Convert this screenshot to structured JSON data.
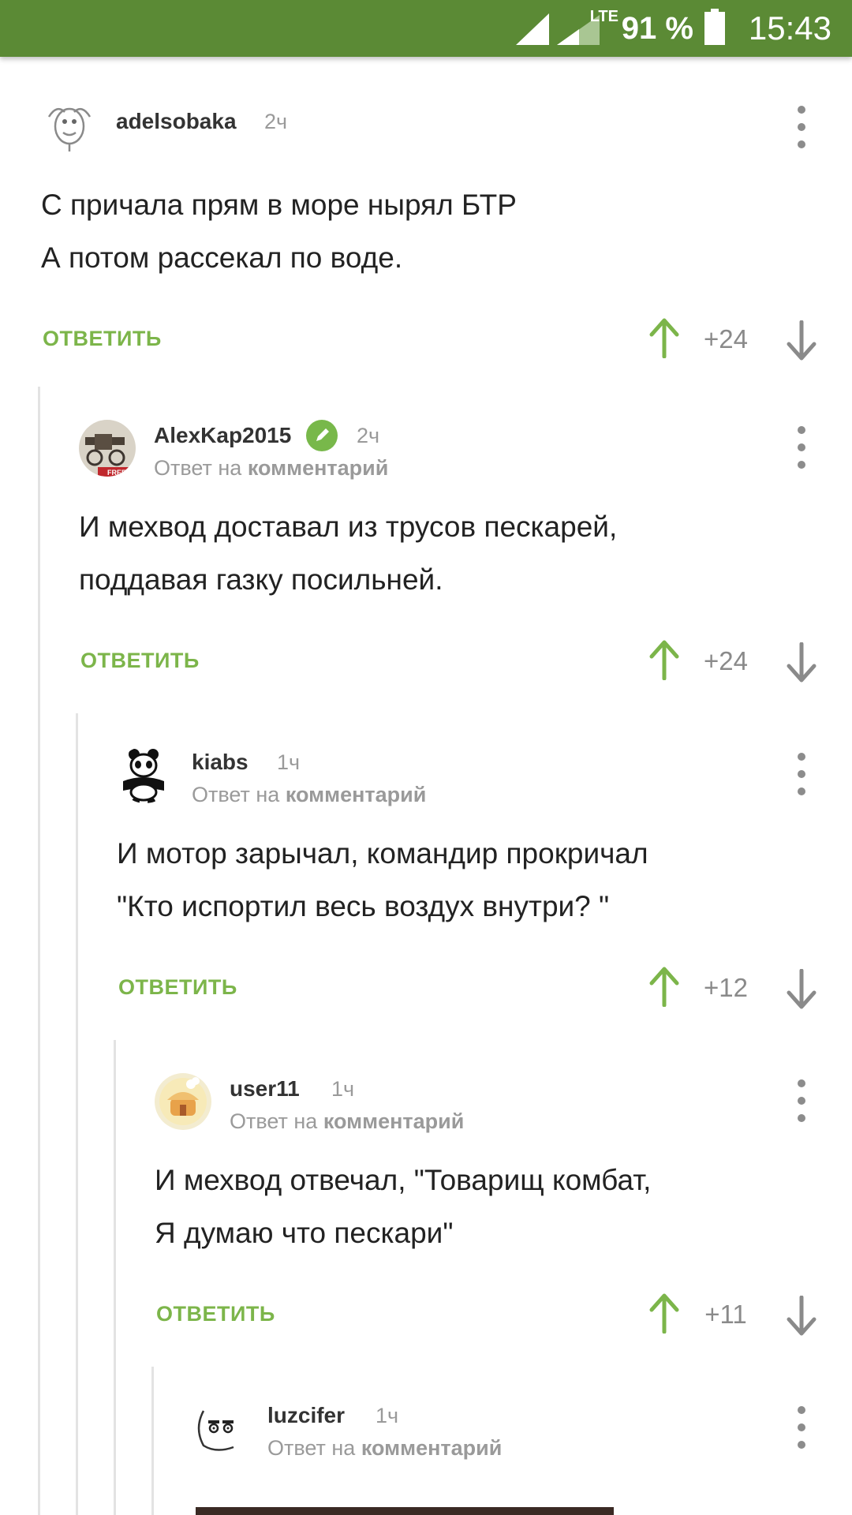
{
  "status_bar": {
    "network": "LTE",
    "battery": "91 %",
    "time": "15:43",
    "bg_color": "#5b8a35"
  },
  "accent_color": "#7cb54a",
  "reply_prefix": "Ответ на",
  "reply_target": "комментарий",
  "comments": [
    {
      "username": "adelsobaka",
      "time": "2ч",
      "lines": [
        "С причала прям в море нырял БТР",
        "А потом рассекал по воде."
      ],
      "reply_label": "ОТВЕТИТЬ",
      "score": "+24",
      "avatar_icon": "dragon-avatar-icon"
    },
    {
      "username": "AlexKap2015",
      "time": "2ч",
      "lines": [
        "И мехвод доставал из трусов пескарей,",
        "поддавая газку посильней."
      ],
      "reply_label": "ОТВЕТИТЬ",
      "score": "+24",
      "avatar_icon": "machine-gun-avatar-icon",
      "badge_icon": "pencil-icon",
      "avatar_text": "FREE"
    },
    {
      "username": "kiabs",
      "time": "1ч",
      "lines": [
        "И мотор зарычал, командир прокричал",
        "\"Кто испортил весь воздух внутри? \""
      ],
      "reply_label": "ОТВЕТИТЬ",
      "score": "+12",
      "avatar_icon": "panda-avatar-icon"
    },
    {
      "username": "user11",
      "time": "1ч",
      "lines": [
        "И мехвод отвечал, \"Товарищ комбат,",
        "Я думаю что пескари\""
      ],
      "reply_label": "ОТВЕТИТЬ",
      "score": "+11",
      "avatar_icon": "house-avatar-icon"
    },
    {
      "username": "luzcifer",
      "time": "1ч",
      "avatar_icon": "face-avatar-icon"
    }
  ]
}
